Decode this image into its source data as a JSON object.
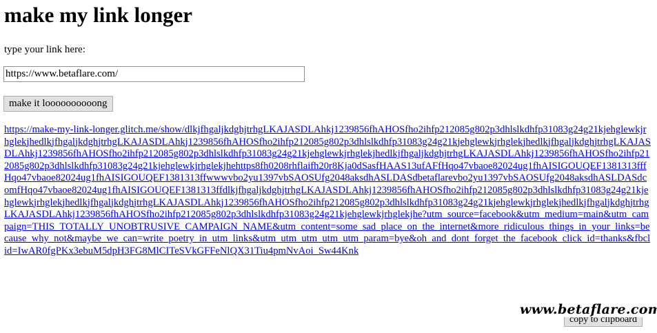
{
  "page": {
    "title": "make my link longer",
    "input_label": "type your link here:",
    "input_value": "https://www.betaflare.com/",
    "submit_label": "make it loooooooooong",
    "long_link": "https://make-my-link-longer.glitch.me/show/dlkjfhgaljkdghjtrhgLKAJASDLAhkj1239856fhAHOSfho2ihfp212085g802p3dhlslkdhfp31083g24g21kjehglewkjrhglekjhedlkjfhgaljkdghjtrhgLKAJASDLAhkj1239856fhAHOSfho2ihfp212085g802p3dhlslkdhfp31083g24g21kjehglewkjrhglekjhedlkjfhgaljkdghjtrhgLKAJASDLAhkj1239856fhAHOSfho2ihfp212085g802p3dhlslkdhfp31083g24g21kjehglewkjrhglekjhedlkjfhgaljkdghjtrhgLKAJASDLAhkj1239856fhAHOSfho2ihfp212085g802p3dhlslkdhfp31083g24g21kjehglewkjrhglekjhehttps8fh0208rhflaifh20r8Kja0dSasfHAAS13ufAFfHqo47vbaoe82024ug1fhAISIGOUQEF1381313fffHqo47vbaoe82024ug1fhAISIGOUQEF1381313ffwwwvbo2yu1397vbSAOSUfg2048aksdhASLDASdbetaflarevbo2yu1397vbSAOSUfg2048aksdhASLDASdcomfHqo47vbaoe82024ug1fhAISIGOUQEF1381313ffdlkjfhgaljkdghjtrhgLKAJASDLAhkj1239856fhAHOSfho2ihfp212085g802p3dhlslkdhfp31083g24g21kjehglewkjrhglekjhedlkjfhgaljkdghjtrhgLKAJASDLAhkj1239856fhAHOSfho2ihfp212085g802p3dhlslkdhfp31083g24g21kjehglewkjrhglekjhedlkjfhgaljkdghjtrhgLKAJASDLAhkj1239856fhAHOSfho2ihfp212085g802p3dhlslkdhfp31083g24g21kjehglewkjrhglekjhe?utm_source=facebook&utm_medium=main&utm_campaign=THIS_TOTALLY_UNOBTRUSIVE_CAMPAIGN_NAME&utm_content=some_sad_place_on_the_internet&more_ridiculous_things_in_your_links=because_why_not&maybe_we_can=write_poetry_in_utm_links&utm_utm_utm_utm_utm_param=bye&oh_and_dont_forget_the_facebook_click_id=thanks&fbclid=IwAR0fgPKx3ebuM5dpH3FG8MlCITeSVkGFFeNlQX31Tiu4pmNvAoi_Sw44Knk",
    "copy_label": "copy to clipboard",
    "watermark": "www.betaflare.com"
  }
}
